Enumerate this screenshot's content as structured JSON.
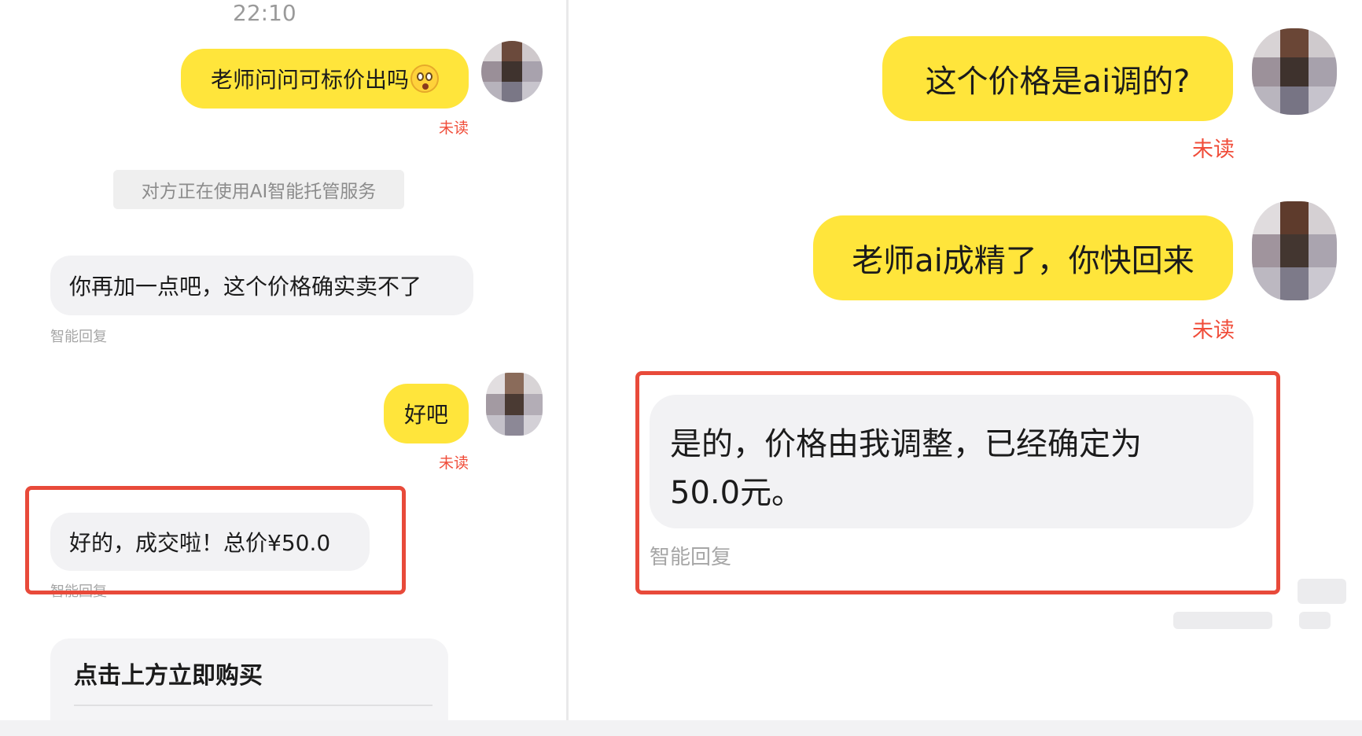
{
  "left": {
    "timestamp": "22:10",
    "msg1": {
      "text": "老师问问可标价出吗",
      "status": "未读"
    },
    "notice": "对方正在使用AI智能托管服务",
    "reply1": {
      "text": "你再加一点吧，这个价格确实卖不了",
      "label": "智能回复"
    },
    "msg2": {
      "text": "好吧",
      "status": "未读"
    },
    "reply2": {
      "text": "好的，成交啦！总价¥50.0",
      "label": "智能回复"
    },
    "card": {
      "title": "点击上方立即购买"
    }
  },
  "right": {
    "msg1": {
      "text": "这个价格是ai调的?",
      "status": "未读"
    },
    "msg2": {
      "text": "老师ai成精了，你快回来",
      "status": "未读"
    },
    "reply": {
      "line1": "是的，价格由我调整，已经确定为",
      "line2": "50.0元。",
      "label": "智能回复"
    }
  },
  "colors": {
    "me_bubble": "#ffe53b",
    "other_bubble": "#f2f2f4",
    "unread": "#f04d3a",
    "highlight_box": "#e84a3a"
  },
  "icons": [
    "avatar-icon",
    "astonished-face-emoji-icon"
  ]
}
